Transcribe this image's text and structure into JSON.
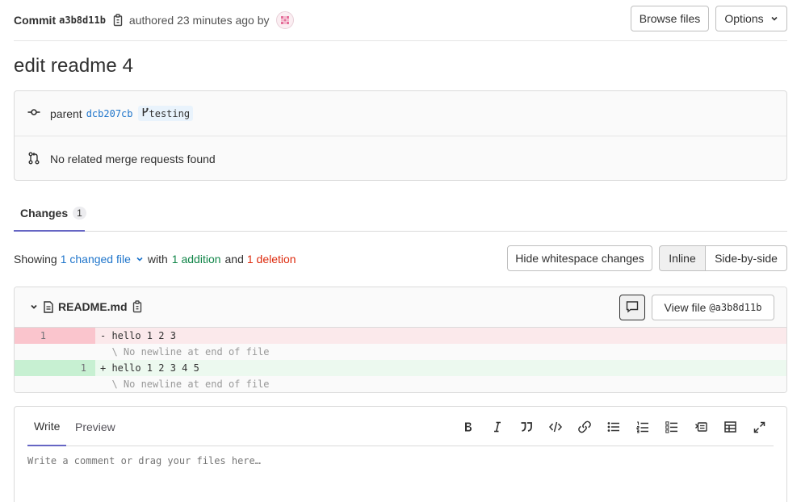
{
  "header": {
    "commit_label": "Commit",
    "commit_sha": "a3b8d11b",
    "authored_text": "authored 23 minutes ago by",
    "browse_files_label": "Browse files",
    "options_label": "Options"
  },
  "title": "edit readme 4",
  "info": {
    "parent_label": "parent",
    "parent_sha": "dcb207cb",
    "branch_name": "testing",
    "merge_requests_text": "No related merge requests found"
  },
  "tabs": {
    "changes_label": "Changes",
    "changes_count": "1"
  },
  "summary": {
    "showing": "Showing",
    "changed_files": "1 changed file",
    "with": "with",
    "additions": "1 addition",
    "and": "and",
    "deletions": "1 deletion",
    "hide_whitespace_label": "Hide whitespace changes",
    "inline_label": "Inline",
    "side_by_side_label": "Side-by-side"
  },
  "diff": {
    "file_name": "README.md",
    "view_file_label": "View file",
    "view_file_sha": "@a3b8d11b",
    "lines": [
      {
        "old": "1",
        "new": "",
        "text": "- hello 1 2 3"
      },
      {
        "old": "",
        "new": "",
        "text": "  \\ No newline at end of file"
      },
      {
        "old": "",
        "new": "1",
        "text": "+ hello 1 2 3 4 5"
      },
      {
        "old": "",
        "new": "",
        "text": "  \\ No newline at end of file"
      }
    ]
  },
  "comment": {
    "write_label": "Write",
    "preview_label": "Preview",
    "placeholder": "Write a comment or drag your files here…",
    "toolbar_icons": [
      "bold-icon",
      "italic-icon",
      "quote-icon",
      "code-icon",
      "link-icon",
      "bullet-list-icon",
      "numbered-list-icon",
      "task-list-icon",
      "collapsible-icon",
      "table-icon",
      "fullscreen-icon"
    ]
  }
}
